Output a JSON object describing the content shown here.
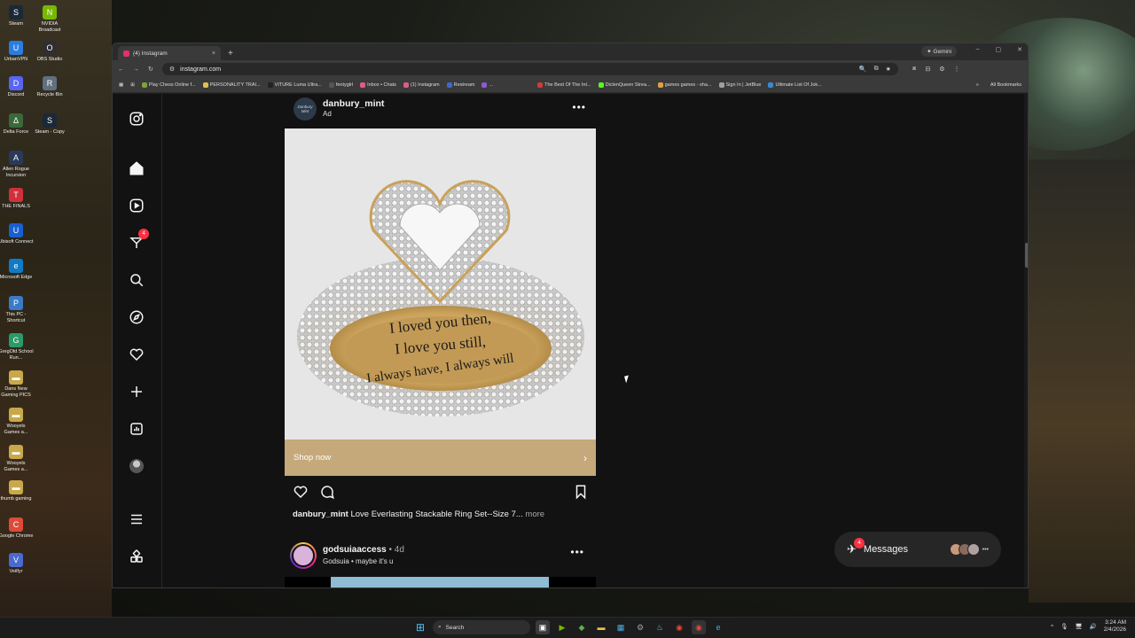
{
  "desktop": {
    "icons": [
      {
        "label": "Steam",
        "glyph": "S",
        "color": "#1b2838"
      },
      {
        "label": "NVIDIA Broadcast",
        "glyph": "N",
        "color": "#76b900"
      },
      {
        "label": "UrbanVPN",
        "glyph": "U",
        "color": "#2a7de1"
      },
      {
        "label": "OBS Studio",
        "glyph": "O",
        "color": "#302e31"
      },
      {
        "label": "Discord",
        "glyph": "D",
        "color": "#5865f2"
      },
      {
        "label": "Recycle Bin",
        "glyph": "R",
        "color": "#607080"
      },
      {
        "label": "Delta Force",
        "glyph": "Δ",
        "color": "#3a6a3a"
      },
      {
        "label": "Steam - Copy",
        "glyph": "S",
        "color": "#1b2838"
      },
      {
        "label": "Allen Rogue Incursion",
        "glyph": "A",
        "color": "#2a3a5a"
      },
      {
        "label": "THE FINALS",
        "glyph": "T",
        "color": "#d0303a"
      },
      {
        "label": "Ubisoft Connect",
        "glyph": "U",
        "color": "#1a5fd0"
      },
      {
        "label": "Microsoft Edge",
        "glyph": "e",
        "color": "#0f7bc7"
      },
      {
        "label": "This PC - Shortcut",
        "glyph": "P",
        "color": "#3a7ac7"
      },
      {
        "label": "GregOld School Run...",
        "glyph": "G",
        "color": "#2a9a6a"
      },
      {
        "label": "Dans New Gaming PICS",
        "glyph": "▬",
        "color": "#c9a84a"
      },
      {
        "label": "Wooyels Games a...",
        "glyph": "▬",
        "color": "#c9a84a"
      },
      {
        "label": "Wooyels Games a...",
        "glyph": "▬",
        "color": "#c9a84a"
      },
      {
        "label": "thumb gaming",
        "glyph": "▬",
        "color": "#c9a84a"
      },
      {
        "label": "Google Chrome",
        "glyph": "C",
        "color": "#dd4b39"
      },
      {
        "label": "Veilfyr",
        "glyph": "V",
        "color": "#4a6ad0"
      }
    ]
  },
  "browser": {
    "tab_title": "(4) Instagram",
    "tab_close": "×",
    "new_tab": "+",
    "gemini_label": "✦ Gemini",
    "window_controls": [
      "–",
      "▢",
      "✕"
    ],
    "nav_buttons": [
      "←",
      "→",
      "↻"
    ],
    "url": "instagram.com",
    "omnibox_icons": [
      "🔍",
      "⧉",
      "★"
    ],
    "toolbar_icons": [
      "⧈",
      "⊟",
      "⚙",
      "⋮"
    ],
    "bookmarks": [
      {
        "label": "Play Chess Online f...",
        "color": "#7aa33a"
      },
      {
        "label": "PERSONALITY TRAI...",
        "color": "#e0c050"
      },
      {
        "label": "VITURE Luma Ultra...",
        "color": "#222222"
      },
      {
        "label": "fentyglrl",
        "color": "#555555"
      },
      {
        "label": "Inbox • Chats",
        "color": "#e05a8a"
      },
      {
        "label": "(1) Instagram",
        "color": "#e05a8a"
      },
      {
        "label": "Restream",
        "color": "#3a6ad0"
      },
      {
        "label": "...",
        "color": "#8a5ad0"
      },
      {
        "label": "The Best Of The Int...",
        "color": "#d03a3a"
      },
      {
        "label": "DiclenQueen Strea...",
        "color": "#53fc18"
      },
      {
        "label": "games games - sha...",
        "color": "#e0a040"
      },
      {
        "label": "Sign In | JetBlue",
        "color": "#9aa0a6"
      },
      {
        "label": "Ultimate List Of Jok...",
        "color": "#3a8ad0"
      }
    ],
    "bookmarks_more": "»",
    "all_bookmarks": "All Bookmarks"
  },
  "instagram": {
    "notifications_count": "4",
    "post": {
      "username": "danbury_mint",
      "subtitle": "Ad",
      "avatar_text": "Danbury Mint",
      "more": "•••",
      "engraving": [
        "I loved you then,",
        "I love you still,",
        "I always have, I always will"
      ],
      "cta": "Shop now",
      "cta_chevron": "›",
      "caption_user": "danbury_mint",
      "caption_text": "Love Everlasting Stackable Ring Set--Size 7...",
      "caption_more": "more"
    },
    "post2": {
      "username": "godsuiaaccess",
      "time": "• 4d",
      "subtitle": "Godsuia • maybe it's u",
      "more": "•••"
    },
    "messages": {
      "label": "Messages",
      "badge": "4",
      "more": "•••"
    }
  },
  "taskbar": {
    "search_placeholder": "Search",
    "time": "3:24 AM",
    "date": "2/4/2026",
    "tray_icons": [
      "^",
      "🎙",
      "🖥",
      "🔊"
    ]
  }
}
